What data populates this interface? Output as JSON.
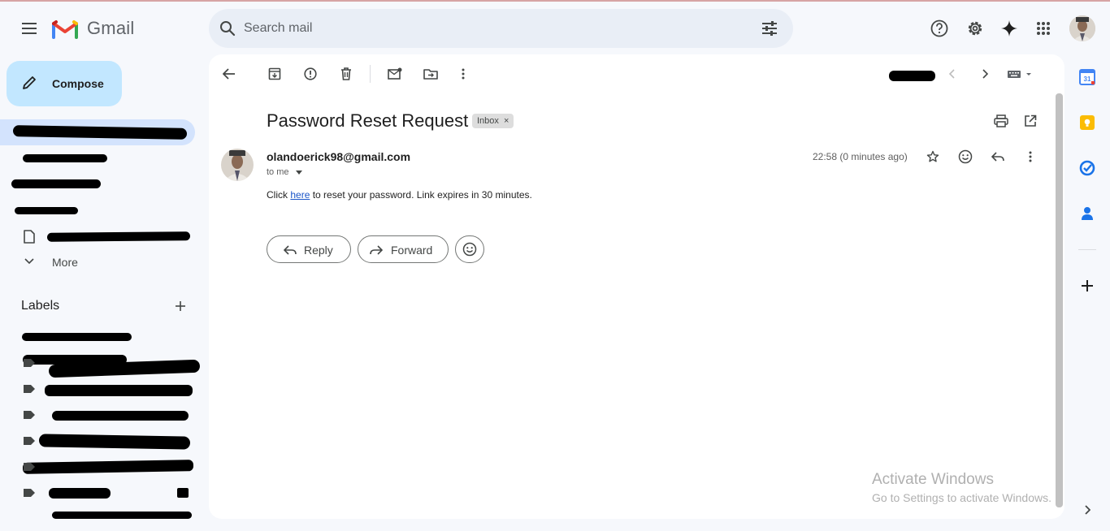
{
  "header": {
    "app_name": "Gmail",
    "search_placeholder": "Search mail"
  },
  "nav": {
    "compose_label": "Compose",
    "more_label": "More",
    "labels_title": "Labels"
  },
  "email": {
    "subject": "Password Reset Request",
    "inbox_chip": "Inbox",
    "chip_close": "×",
    "sender": "olandoerick98@gmail.com",
    "to_me": "to me",
    "timestamp": "22:58 (0 minutes ago)",
    "body_prefix": "Click ",
    "body_link": "here",
    "body_suffix": " to reset your password. Link expires in 30 minutes.",
    "reply_label": "Reply",
    "forward_label": "Forward"
  },
  "watermark": {
    "line1": "Activate Windows",
    "line2": "Go to Settings to activate Windows."
  },
  "colors": {
    "compose_bg": "#c2e7ff",
    "active_nav": "#d3e3fd",
    "search_bg": "#e9eef6",
    "link": "#1a55c8"
  },
  "icons": [
    "menu-icon",
    "gmail-logo-icon",
    "search-icon",
    "filter-icon",
    "help-icon",
    "settings-icon",
    "gemini-icon",
    "apps-icon",
    "avatar",
    "back-icon",
    "archive-icon",
    "report-spam-icon",
    "delete-icon",
    "mark-unread-icon",
    "move-to-icon",
    "more-vert-icon",
    "prev-icon",
    "next-icon",
    "keyboard-icon",
    "print-icon",
    "open-new-window-icon",
    "star-icon",
    "emoji-icon",
    "reply-icon",
    "calendar-icon",
    "keep-icon",
    "tasks-icon",
    "contacts-icon",
    "add-icon",
    "chevron-right-icon"
  ]
}
